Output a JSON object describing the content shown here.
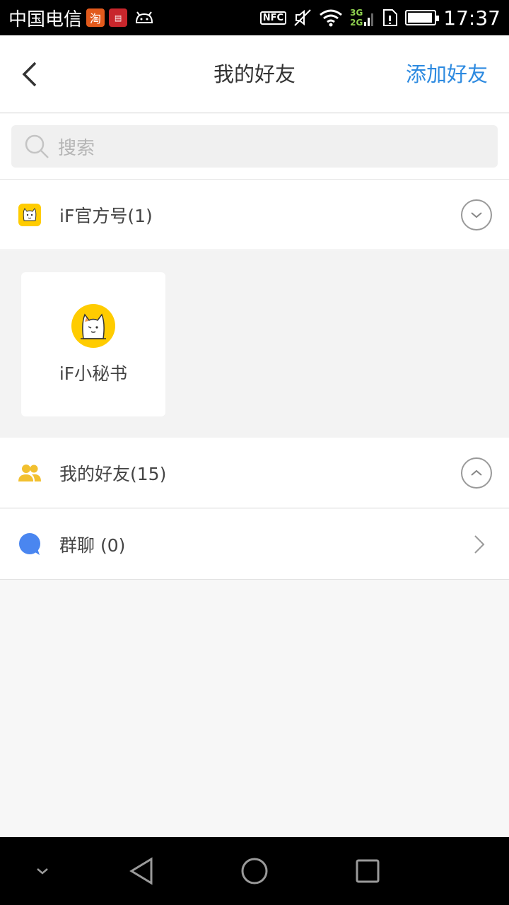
{
  "status_bar": {
    "carrier": "中国电信",
    "taobao_glyph": "淘",
    "time": "17:37",
    "network_top": "3G",
    "network_bottom": "2G",
    "nfc": "NFC"
  },
  "header": {
    "title": "我的好友",
    "add_friend": "添加好友",
    "back_icon": "chevron-left-icon"
  },
  "search": {
    "placeholder": "搜索",
    "icon": "search-icon"
  },
  "sections": {
    "official": {
      "label": "iF官方号(1)",
      "icon": "cat-icon",
      "toggle_icon": "chevron-down-circle-icon",
      "items": [
        {
          "name": "iF小秘书",
          "avatar": "cat-avatar"
        }
      ]
    },
    "friends": {
      "label": "我的好友(15)",
      "icon": "people-icon",
      "toggle_icon": "chevron-up-circle-icon"
    },
    "group_chat": {
      "label": "群聊 (0)",
      "icon": "chat-bubble-icon",
      "arrow_icon": "chevron-right-icon"
    }
  },
  "colors": {
    "accent": "#2d8ae0",
    "friends_icon": "#f2c02f",
    "group_icon": "#4a86f0",
    "official_icon": "#ffcc00"
  }
}
